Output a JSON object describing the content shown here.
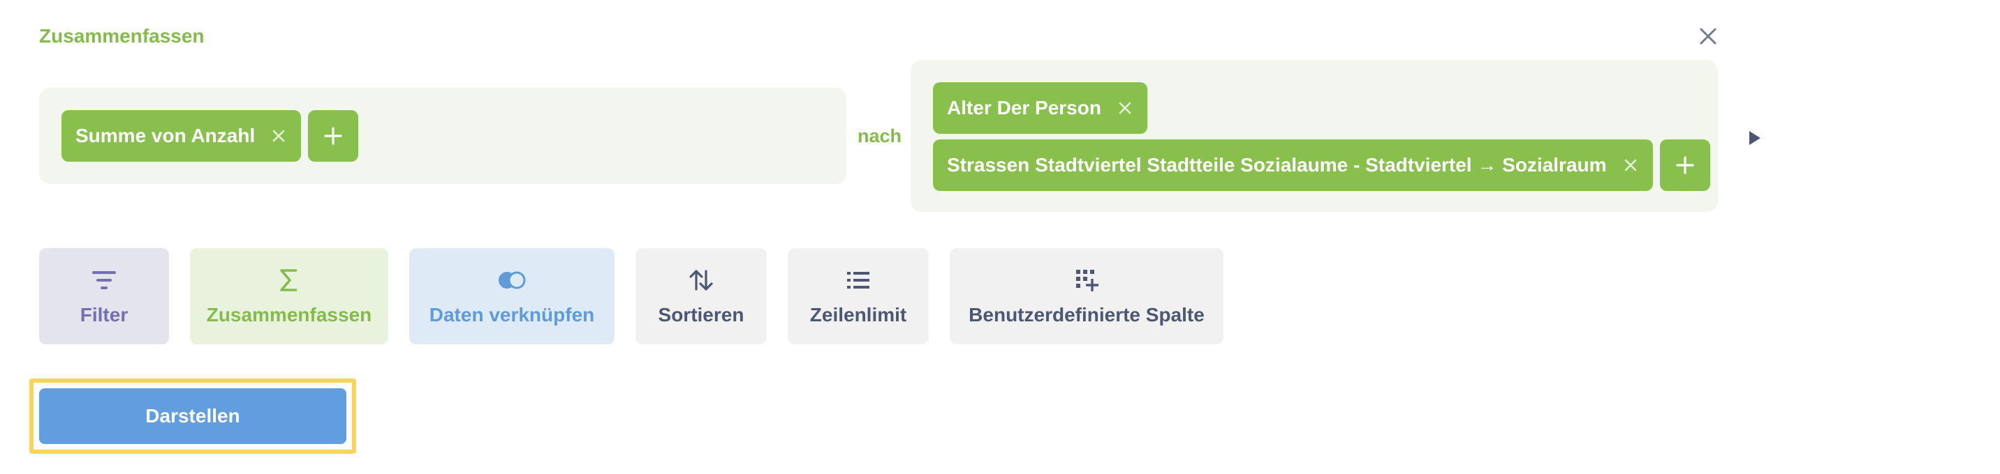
{
  "header": {
    "title": "Zusammenfassen"
  },
  "metrics": {
    "items": [
      {
        "label": "Summe von Anzahl"
      }
    ]
  },
  "connector": "nach",
  "breakouts": {
    "items": [
      {
        "label": "Alter Der Person"
      },
      {
        "label": "Strassen Stadtviertel Stadtteile Sozialaume - Stadtviertel → Sozialraum"
      }
    ]
  },
  "actions": {
    "filter": "Filter",
    "summarize": "Zusammenfassen",
    "join": "Daten verknüpfen",
    "sort": "Sortieren",
    "limit": "Zeilenlimit",
    "custom_column": "Benutzerdefinierte Spalte"
  },
  "run_button": "Darstellen",
  "colors": {
    "summarize_accent": "#88bf4d",
    "filter_accent": "#7172ad",
    "join_accent": "#5f9ad9",
    "run_button": "#629edf",
    "focus_ring": "#f9d45c"
  },
  "icons": {
    "close": "close-icon",
    "remove": "x-icon",
    "add": "plus-icon",
    "expand": "play-arrow-icon",
    "filter": "filter-icon",
    "summarize": "sigma-icon",
    "join": "join-icon",
    "sort": "sort-arrows-icon",
    "limit": "list-icon",
    "custom_column": "add-column-icon"
  }
}
